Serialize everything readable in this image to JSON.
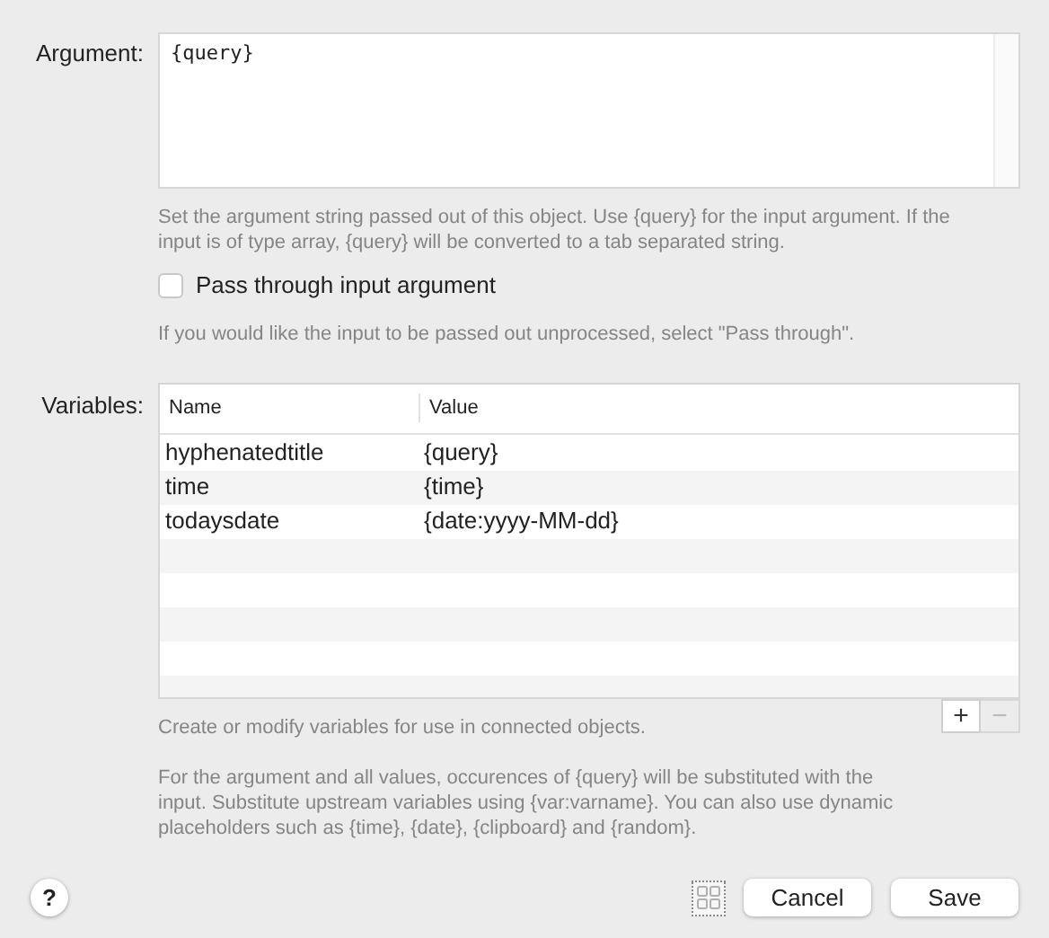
{
  "argument": {
    "label": "Argument:",
    "value": "{query}",
    "help": "Set the argument string passed out of this object. Use {query} for the input argument. If the input is of type array, {query} will be converted to a tab separated string."
  },
  "pass_through": {
    "label": "Pass through input argument",
    "checked": false,
    "help": "If you would like the input to be passed out unprocessed, select \"Pass through\"."
  },
  "variables": {
    "label": "Variables:",
    "columns": [
      "Name",
      "Value"
    ],
    "rows": [
      {
        "name": "hyphenatedtitle",
        "value": "{query}"
      },
      {
        "name": "time",
        "value": "{time}"
      },
      {
        "name": "todaysdate",
        "value": "{date:yyyy-MM-dd}"
      }
    ],
    "add_button": "+",
    "remove_button": "−",
    "help": "Create or modify variables for use in connected objects."
  },
  "note": "For the argument and all values, occurences of {query} will be substituted with the input. Substitute upstream variables using {var:varname}. You can also use dynamic placeholders such as {time}, {date}, {clipboard} and {random}.",
  "buttons": {
    "help": "?",
    "cancel": "Cancel",
    "save": "Save"
  }
}
